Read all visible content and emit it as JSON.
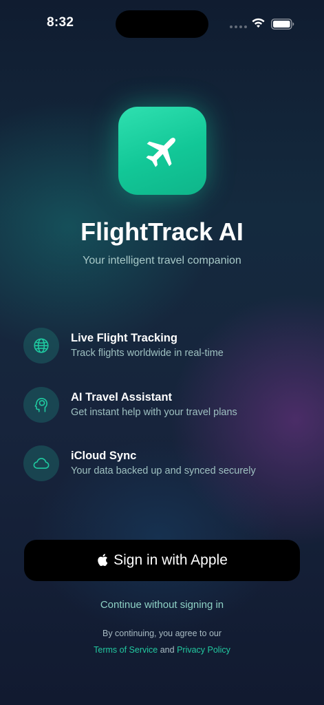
{
  "status_bar": {
    "time": "8:32"
  },
  "app": {
    "icon": "airplane-icon",
    "title": "FlightTrack AI",
    "subtitle": "Your intelligent travel companion"
  },
  "features": [
    {
      "icon": "globe-icon",
      "title": "Live Flight Tracking",
      "description": "Track flights worldwide in real-time"
    },
    {
      "icon": "brain-head-icon",
      "title": "AI Travel Assistant",
      "description": "Get instant help with your travel plans"
    },
    {
      "icon": "cloud-icon",
      "title": "iCloud Sync",
      "description": "Your data backed up and synced securely"
    }
  ],
  "actions": {
    "apple_sign_in_label": "Sign in with Apple",
    "continue_label": "Continue without signing in"
  },
  "legal": {
    "prefix": "By continuing, you agree to our",
    "terms_label": "Terms of Service",
    "conjunction": "and",
    "privacy_label": "Privacy Policy"
  },
  "colors": {
    "accent": "#18c99c",
    "icon_gradient_top": "#2fe0b0",
    "icon_gradient_bottom": "#0fb58a",
    "link": "#22c9a0",
    "subtitle": "#a8c9c8",
    "button_bg": "#000000"
  }
}
